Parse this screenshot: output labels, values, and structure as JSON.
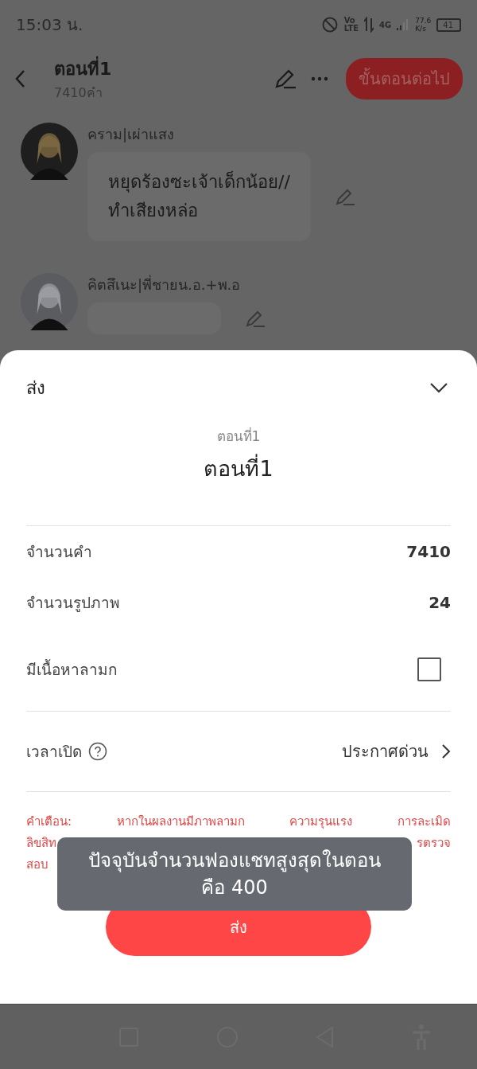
{
  "status_bar": {
    "time": "15:03 น.",
    "volte_top": "Vo",
    "volte_bottom": "LTE",
    "network": "4G",
    "speed": "77.6",
    "speed_unit": "K/s",
    "battery": "41"
  },
  "header": {
    "title": "ตอนที่1",
    "subtitle": "7410คำ",
    "next_button": "ขั้นตอนต่อไป"
  },
  "messages": [
    {
      "author": "คราม|เผ่าแสง",
      "lines": [
        "หยุดร้องซะเจ้าเด็กน้อย//",
        "ทำเสียงหล่อ"
      ]
    },
    {
      "author": "คิตสึเนะ|พี่ชายน.อ.+พ.อ"
    }
  ],
  "sheet": {
    "title": "ส่ง",
    "episode_label": "ตอนที่1",
    "episode_title": "ตอนที่1",
    "rows": [
      {
        "kind": "value",
        "label": "จำนวนคำ",
        "value": "7410"
      },
      {
        "kind": "value",
        "label": "จำนวนรูปภาพ",
        "value": "24"
      },
      {
        "kind": "checkbox",
        "label": "มีเนื้อหาลามก",
        "checked": false
      }
    ],
    "open_time": {
      "label": "เวลาเปิด",
      "value": "ประกาศด่วน"
    },
    "warning": {
      "line_1": "คำเตือน: หากในผลงานมีภาพลามก ความรุนแรง การละเมิด",
      "line_2_start": "ลิขสิท",
      "line_2_end": "รตรวจ",
      "line_3": "สอบ"
    },
    "submit_button": "ส่ง"
  },
  "toast": {
    "lines": [
      "ปัจจุบันจำนวนฟองแชทสูงสุดในตอน",
      "คือ 400"
    ]
  }
}
